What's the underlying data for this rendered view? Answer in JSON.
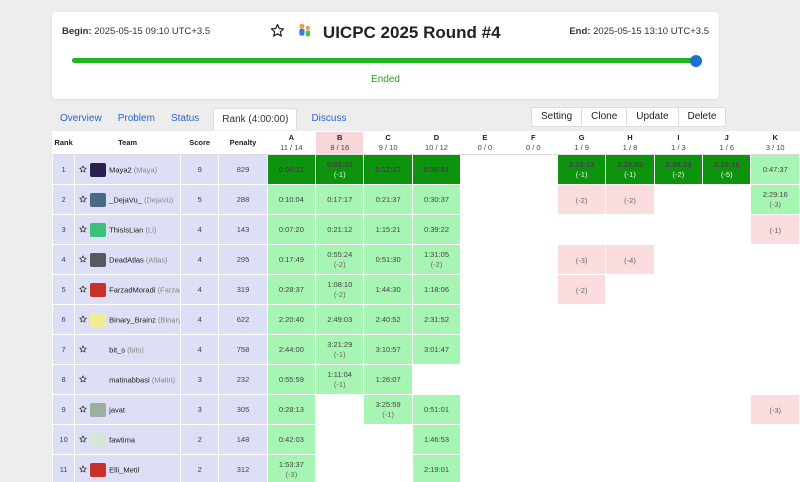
{
  "contest": {
    "begin_label": "Begin:",
    "begin_value": "2025-05-15 09:10 UTC+3.5",
    "end_label": "End:",
    "end_value": "2025-05-15 13:10 UTC+3.5",
    "title": "UICPC 2025 Round #4",
    "status": "Ended",
    "progress": 1.0,
    "colors": {
      "progress": "#21b521",
      "knob": "#1f6fd1",
      "first_blood": "#0d930d",
      "accepted": "#a7f5b2",
      "wrong": "#fbdde0",
      "team_bg": "#dcdff6"
    }
  },
  "tabs": [
    {
      "label": "Overview",
      "active": false
    },
    {
      "label": "Problem",
      "active": false
    },
    {
      "label": "Status",
      "active": false
    },
    {
      "label": "Rank (4:00:00)",
      "active": true
    },
    {
      "label": "Discuss",
      "active": false
    }
  ],
  "actions": [
    "Setting",
    "Clone",
    "Update",
    "Delete"
  ],
  "table": {
    "headers": {
      "rank": "Rank",
      "team": "Team",
      "score": "Score",
      "penalty": "Penalty"
    },
    "problems": [
      {
        "letter": "A",
        "stat": "11 / 14"
      },
      {
        "letter": "B",
        "stat": "8 / 16"
      },
      {
        "letter": "C",
        "stat": "9 / 10"
      },
      {
        "letter": "D",
        "stat": "10 / 12"
      },
      {
        "letter": "E",
        "stat": "0 / 0"
      },
      {
        "letter": "F",
        "stat": "0 / 0"
      },
      {
        "letter": "G",
        "stat": "1 / 9"
      },
      {
        "letter": "H",
        "stat": "1 / 8"
      },
      {
        "letter": "I",
        "stat": "1 / 3"
      },
      {
        "letter": "J",
        "stat": "1 / 6"
      },
      {
        "letter": "K",
        "stat": "3 / 10"
      }
    ],
    "rows": [
      {
        "rank": "1",
        "name": "Maya2",
        "alias": "(Maya)",
        "avatar_color": "#2a2050",
        "score": "9",
        "penalty": "829",
        "cells": [
          [
            "fb",
            "0:06:21",
            ""
          ],
          [
            "fb",
            "0:05:06",
            "(-1)"
          ],
          [
            "fb",
            "0:12:17",
            ""
          ],
          [
            "fb",
            "0:26:01",
            ""
          ],
          [
            "empty",
            "",
            ""
          ],
          [
            "empty",
            "",
            ""
          ],
          [
            "fb",
            "2:12:12",
            "(-1)"
          ],
          [
            "fb",
            "1:29:52",
            "(-1)"
          ],
          [
            "fb",
            "2:59:23",
            "(-2)"
          ],
          [
            "fb",
            "2:10:16",
            "(-5)"
          ],
          [
            "ac",
            "0:47:37",
            ""
          ]
        ]
      },
      {
        "rank": "2",
        "name": "_DejaVu_",
        "alias": "(DejaVu)",
        "avatar_color": "#4a6a8a",
        "score": "5",
        "penalty": "288",
        "cells": [
          [
            "ac",
            "0:10:04",
            ""
          ],
          [
            "ac",
            "0:17:17",
            ""
          ],
          [
            "ac",
            "0:21:37",
            ""
          ],
          [
            "ac",
            "0:30:37",
            ""
          ],
          [
            "empty",
            "",
            ""
          ],
          [
            "empty",
            "",
            ""
          ],
          [
            "wa",
            "",
            "(-2)"
          ],
          [
            "wa",
            "",
            "(-2)"
          ],
          [
            "empty",
            "",
            ""
          ],
          [
            "empty",
            "",
            ""
          ],
          [
            "ac",
            "2:29:16",
            "(-3)"
          ]
        ]
      },
      {
        "rank": "3",
        "name": "ThisIsLian",
        "alias": "(Li)",
        "avatar_color": "#3cc07a",
        "score": "4",
        "penalty": "143",
        "cells": [
          [
            "ac",
            "0:07:20",
            ""
          ],
          [
            "ac",
            "0:21:12",
            ""
          ],
          [
            "ac",
            "1:15:21",
            ""
          ],
          [
            "ac",
            "0:39:22",
            ""
          ],
          [
            "empty",
            "",
            ""
          ],
          [
            "empty",
            "",
            ""
          ],
          [
            "empty",
            "",
            ""
          ],
          [
            "empty",
            "",
            ""
          ],
          [
            "empty",
            "",
            ""
          ],
          [
            "empty",
            "",
            ""
          ],
          [
            "wa",
            "",
            "(-1)"
          ]
        ]
      },
      {
        "rank": "4",
        "name": "DeadAtlas",
        "alias": "(Atlas)",
        "avatar_color": "#555a60",
        "score": "4",
        "penalty": "295",
        "cells": [
          [
            "ac",
            "0:17:49",
            ""
          ],
          [
            "ac",
            "0:55:24",
            "(-2)"
          ],
          [
            "ac",
            "0:51:30",
            ""
          ],
          [
            "ac",
            "1:31:05",
            "(-2)"
          ],
          [
            "empty",
            "",
            ""
          ],
          [
            "empty",
            "",
            ""
          ],
          [
            "wa",
            "",
            "(-3)"
          ],
          [
            "wa",
            "",
            "(-4)"
          ],
          [
            "empty",
            "",
            ""
          ],
          [
            "empty",
            "",
            ""
          ],
          [
            "empty",
            "",
            ""
          ]
        ]
      },
      {
        "rank": "5",
        "name": "FarzadMoradi",
        "alias": "(Farzad)",
        "avatar_color": "#c8322a",
        "score": "4",
        "penalty": "319",
        "cells": [
          [
            "ac",
            "0:28:37",
            ""
          ],
          [
            "ac",
            "1:08:10",
            "(-2)"
          ],
          [
            "ac",
            "1:44:30",
            ""
          ],
          [
            "ac",
            "1:18:06",
            ""
          ],
          [
            "empty",
            "",
            ""
          ],
          [
            "empty",
            "",
            ""
          ],
          [
            "wa",
            "",
            "(-2)"
          ],
          [
            "empty",
            "",
            ""
          ],
          [
            "empty",
            "",
            ""
          ],
          [
            "empty",
            "",
            ""
          ],
          [
            "empty",
            "",
            ""
          ]
        ]
      },
      {
        "rank": "6",
        "name": "Binary_Brainz",
        "alias": "(Binary ...",
        "avatar_color": "#f1ec9a",
        "score": "4",
        "penalty": "622",
        "cells": [
          [
            "ac",
            "2:20:40",
            ""
          ],
          [
            "ac",
            "2:49:03",
            ""
          ],
          [
            "ac",
            "2:40:52",
            ""
          ],
          [
            "ac",
            "2:31:52",
            ""
          ],
          [
            "empty",
            "",
            ""
          ],
          [
            "empty",
            "",
            ""
          ],
          [
            "empty",
            "",
            ""
          ],
          [
            "empty",
            "",
            ""
          ],
          [
            "empty",
            "",
            ""
          ],
          [
            "empty",
            "",
            ""
          ],
          [
            "empty",
            "",
            ""
          ]
        ]
      },
      {
        "rank": "7",
        "name": "bit_s",
        "alias": "(bits)",
        "avatar_color": "#dcdff6",
        "score": "4",
        "penalty": "758",
        "cells": [
          [
            "ac",
            "2:44:00",
            ""
          ],
          [
            "ac",
            "3:21:29",
            "(-1)"
          ],
          [
            "ac",
            "3:10:57",
            ""
          ],
          [
            "ac",
            "3:01:47",
            ""
          ],
          [
            "empty",
            "",
            ""
          ],
          [
            "empty",
            "",
            ""
          ],
          [
            "empty",
            "",
            ""
          ],
          [
            "empty",
            "",
            ""
          ],
          [
            "empty",
            "",
            ""
          ],
          [
            "empty",
            "",
            ""
          ],
          [
            "empty",
            "",
            ""
          ]
        ]
      },
      {
        "rank": "8",
        "name": "matinabbasi",
        "alias": "(Matin)",
        "avatar_color": "#dcdff6",
        "score": "3",
        "penalty": "232",
        "cells": [
          [
            "ac",
            "0:55:59",
            ""
          ],
          [
            "ac",
            "1:11:04",
            "(-1)"
          ],
          [
            "ac",
            "1:26:07",
            ""
          ],
          [
            "empty",
            "",
            ""
          ],
          [
            "empty",
            "",
            ""
          ],
          [
            "empty",
            "",
            ""
          ],
          [
            "empty",
            "",
            ""
          ],
          [
            "empty",
            "",
            ""
          ],
          [
            "empty",
            "",
            ""
          ],
          [
            "empty",
            "",
            ""
          ],
          [
            "empty",
            "",
            ""
          ]
        ]
      },
      {
        "rank": "9",
        "name": "javat",
        "alias": "",
        "avatar_color": "#9ab0a0",
        "score": "3",
        "penalty": "305",
        "cells": [
          [
            "ac",
            "0:28:13",
            ""
          ],
          [
            "empty",
            "",
            ""
          ],
          [
            "ac",
            "3:25:59",
            "(-1)"
          ],
          [
            "ac",
            "0:51:01",
            ""
          ],
          [
            "empty",
            "",
            ""
          ],
          [
            "empty",
            "",
            ""
          ],
          [
            "empty",
            "",
            ""
          ],
          [
            "empty",
            "",
            ""
          ],
          [
            "empty",
            "",
            ""
          ],
          [
            "empty",
            "",
            ""
          ],
          [
            "wa",
            "",
            "(-3)"
          ]
        ]
      },
      {
        "rank": "10",
        "name": "fawtima",
        "alias": "",
        "avatar_color": "#d6e6d6",
        "score": "2",
        "penalty": "148",
        "cells": [
          [
            "ac",
            "0:42:03",
            ""
          ],
          [
            "empty",
            "",
            ""
          ],
          [
            "empty",
            "",
            ""
          ],
          [
            "ac",
            "1:46:53",
            ""
          ],
          [
            "empty",
            "",
            ""
          ],
          [
            "empty",
            "",
            ""
          ],
          [
            "empty",
            "",
            ""
          ],
          [
            "empty",
            "",
            ""
          ],
          [
            "empty",
            "",
            ""
          ],
          [
            "empty",
            "",
            ""
          ],
          [
            "empty",
            "",
            ""
          ]
        ]
      },
      {
        "rank": "11",
        "name": "Elli_Metil",
        "alias": "",
        "avatar_color": "#c8322a",
        "score": "2",
        "penalty": "312",
        "cells": [
          [
            "ac",
            "1:53:37",
            "(-3)"
          ],
          [
            "empty",
            "",
            ""
          ],
          [
            "empty",
            "",
            ""
          ],
          [
            "ac",
            "2:19:01",
            ""
          ],
          [
            "empty",
            "",
            ""
          ],
          [
            "empty",
            "",
            ""
          ],
          [
            "empty",
            "",
            ""
          ],
          [
            "empty",
            "",
            ""
          ],
          [
            "empty",
            "",
            ""
          ],
          [
            "empty",
            "",
            ""
          ],
          [
            "empty",
            "",
            ""
          ]
        ]
      }
    ]
  }
}
